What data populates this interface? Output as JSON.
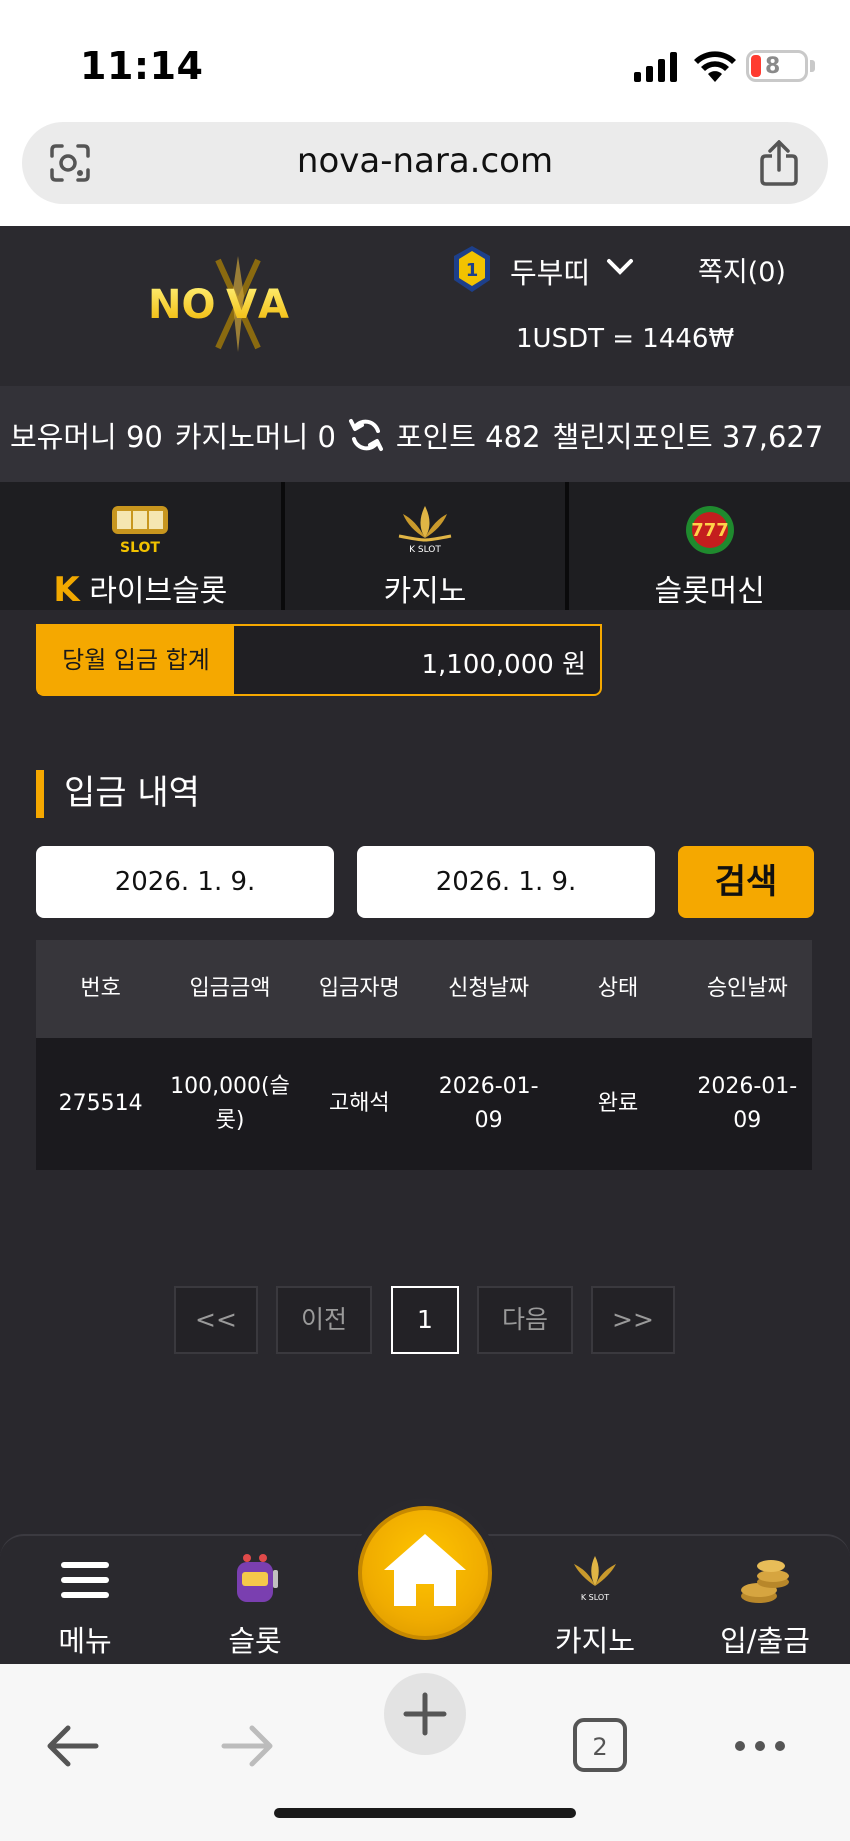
{
  "status_bar": {
    "time": "11:14",
    "battery": "8"
  },
  "browser": {
    "url": "nova-nara.com",
    "tab_count": "2"
  },
  "header": {
    "logo_text": "NOVA",
    "level": "1",
    "username": "두부띠",
    "messages_label": "쪽지(0)",
    "exchange_rate": "1USDT = 1446₩"
  },
  "balance": {
    "money_label": "보유머니 90",
    "casino_money_label": "카지노머니 0",
    "points_label": "포인트 482",
    "challenge_points_label": "챌린지포인트 37,627"
  },
  "tabs": [
    {
      "label": "라이브슬롯",
      "icon": "live-slot-icon"
    },
    {
      "label": "카지노",
      "icon": "k-slot-lotus-icon"
    },
    {
      "label": "슬롯머신",
      "icon": "777-slots-icon"
    }
  ],
  "summary": {
    "label": "당월 입금 합계",
    "value": "1,100,000 원"
  },
  "section_title": "입금 내역",
  "filters": {
    "date_from": "2026. 1. 9.",
    "date_to": "2026. 1. 9.",
    "search_label": "검색"
  },
  "table": {
    "headers": [
      "번호",
      "입금금액",
      "입금자명",
      "신청날짜",
      "상태",
      "승인날짜"
    ],
    "rows": [
      [
        "275514",
        "100,000(슬롯)",
        "고해석",
        "2026-01-09",
        "완료",
        "2026-01-09"
      ]
    ]
  },
  "pagination": {
    "first": "<<",
    "prev": "이전",
    "current": "1",
    "next": "다음",
    "last": ">>"
  },
  "bottom_nav": {
    "menu": "메뉴",
    "slot": "슬롯",
    "casino": "카지노",
    "deposit_withdraw": "입/출금"
  },
  "colors": {
    "accent": "#f5a800",
    "background": "#29282d",
    "header": "#2b2a2f"
  }
}
